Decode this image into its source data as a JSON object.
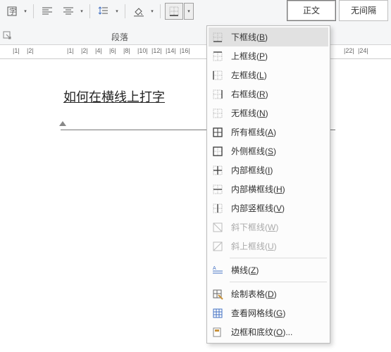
{
  "ribbon": {
    "group_label": "段落",
    "styles": {
      "normal": "正文",
      "no_spacing": "无间隔"
    }
  },
  "ruler_marks": [
    "1",
    "2",
    "1",
    "2",
    "4",
    "6",
    "8",
    "10",
    "12",
    "14",
    "16",
    "22",
    "24"
  ],
  "document": {
    "text": "如何在横线上打字"
  },
  "menu": {
    "items": [
      {
        "label": "下框线",
        "key": "B",
        "highlight": true
      },
      {
        "label": "上框线",
        "key": "P"
      },
      {
        "label": "左框线",
        "key": "L"
      },
      {
        "label": "右框线",
        "key": "R"
      },
      {
        "label": "无框线",
        "key": "N"
      },
      {
        "label": "所有框线",
        "key": "A"
      },
      {
        "label": "外侧框线",
        "key": "S"
      },
      {
        "label": "内部框线",
        "key": "I"
      },
      {
        "label": "内部横框线",
        "key": "H"
      },
      {
        "label": "内部竖框线",
        "key": "V"
      },
      {
        "label": "斜下框线",
        "key": "W",
        "disabled": true
      },
      {
        "label": "斜上框线",
        "key": "U",
        "disabled": true
      }
    ],
    "hr_label": "横线",
    "hr_key": "Z",
    "draw_label": "绘制表格",
    "draw_key": "D",
    "grid_label": "查看网格线",
    "grid_key": "G",
    "shading_label": "边框和底纹",
    "shading_key": "O",
    "shading_suffix": "..."
  }
}
